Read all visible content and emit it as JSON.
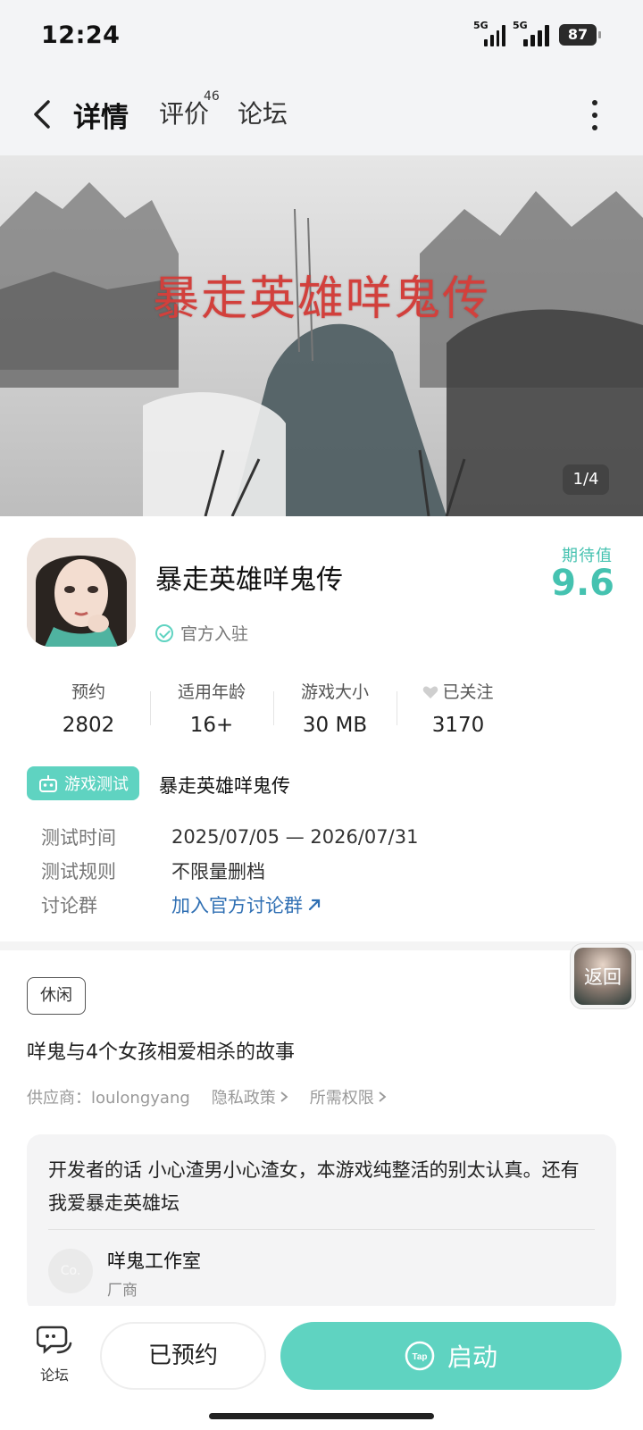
{
  "status": {
    "time": "12:24",
    "network1": "5G",
    "network2": "5G",
    "battery": "87"
  },
  "nav": {
    "tabs": [
      {
        "label": "详情"
      },
      {
        "label": "评价",
        "badge": "46"
      },
      {
        "label": "论坛"
      }
    ]
  },
  "banner": {
    "title": "暴走英雄咩鬼传",
    "counter": "1/4"
  },
  "game": {
    "title": "暴走英雄咩鬼传",
    "official_label": "官方入驻",
    "expect_label": "期待值",
    "expect_value": "9.6"
  },
  "stats": [
    {
      "label": "预约",
      "value": "2802"
    },
    {
      "label": "适用年龄",
      "value": "16+"
    },
    {
      "label": "游戏大小",
      "value": "30 MB"
    },
    {
      "label": "已关注",
      "value": "3170"
    }
  ],
  "test": {
    "badge": "游戏测试",
    "name": "暴走英雄咩鬼传",
    "rows": [
      {
        "key": "测试时间",
        "value": "2025/07/05 — 2026/07/31"
      },
      {
        "key": "测试规则",
        "value": "不限量删档"
      },
      {
        "key": "讨论群",
        "value": "加入官方讨论群"
      }
    ]
  },
  "tag": "休闲",
  "floating_back": "返回",
  "description": "咩鬼与4个女孩相爱相杀的故事",
  "meta": {
    "supplier": "供应商：loulongyang",
    "privacy": "隐私政策",
    "permissions": "所需权限"
  },
  "developer": {
    "words": "开发者的话  小心渣男小心渣女，本游戏纯整活的别太认真。还有我爱暴走英雄坛",
    "avatar_text": "Co.",
    "name": "咩鬼工作室",
    "role": "厂商"
  },
  "bottom": {
    "forum_label": "论坛",
    "reserved_label": "已预约",
    "launch_label": "启动"
  },
  "colors": {
    "accent": "#5fd3c1",
    "expect": "#45c2b0",
    "link": "#2f6fb3",
    "banner_title": "#d2403c"
  }
}
